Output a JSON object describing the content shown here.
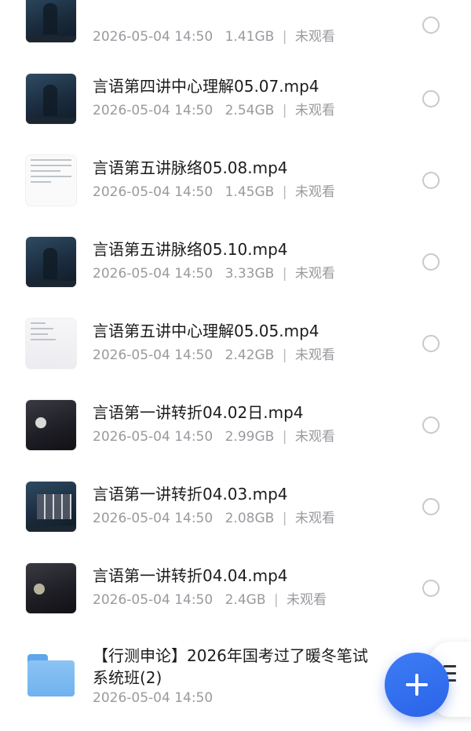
{
  "files": [
    {
      "title": "",
      "date": "2026-05-04 14:50",
      "size": "1.41GB",
      "status": "未观看"
    },
    {
      "title": "言语第四讲中心理解05.07.mp4",
      "date": "2026-05-04 14:50",
      "size": "2.54GB",
      "status": "未观看"
    },
    {
      "title": "言语第五讲脉络05.08.mp4",
      "date": "2026-05-04 14:50",
      "size": "1.45GB",
      "status": "未观看"
    },
    {
      "title": "言语第五讲脉络05.10.mp4",
      "date": "2026-05-04 14:50",
      "size": "3.33GB",
      "status": "未观看"
    },
    {
      "title": "言语第五讲中心理解05.05.mp4",
      "date": "2026-05-04 14:50",
      "size": "2.42GB",
      "status": "未观看"
    },
    {
      "title": "言语第一讲转折04.02日.mp4",
      "date": "2026-05-04 14:50",
      "size": "2.99GB",
      "status": "未观看"
    },
    {
      "title": "言语第一讲转折04.03.mp4",
      "date": "2026-05-04 14:50",
      "size": "2.08GB",
      "status": "未观看"
    },
    {
      "title": "言语第一讲转折04.04.mp4",
      "date": "2026-05-04 14:50",
      "size": "2.4GB",
      "status": "未观看"
    }
  ],
  "separator": "|",
  "folder": {
    "title": "【行测申论】2026年国考过了暖冬笔试系统班(2)",
    "date": "2026-05-04 14:50"
  },
  "icons": {
    "fab": "plus-icon",
    "side": "menu-icon",
    "folder": "folder-icon",
    "radio": "radio-unchecked-icon"
  },
  "colors": {
    "accent": "#2a63e8",
    "folder": "#6fb2f0",
    "muted_text": "#9a9a9f"
  }
}
